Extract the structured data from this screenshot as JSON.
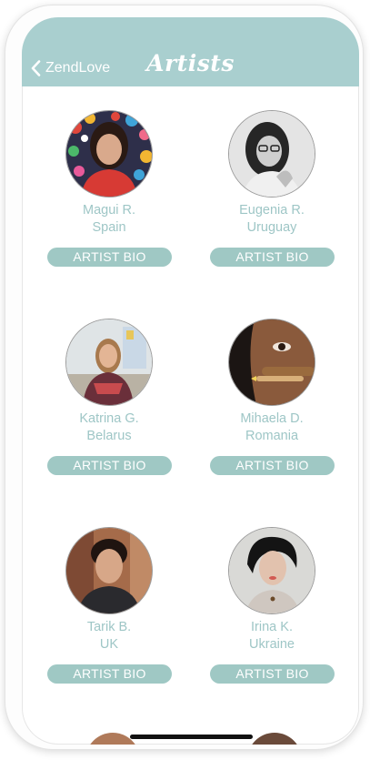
{
  "navbar": {
    "back_label": "ZendLove",
    "title": "Artists"
  },
  "artists": [
    {
      "name": "Magui R.",
      "country": "Spain",
      "button": "ARTIST BIO"
    },
    {
      "name": "Eugenia R.",
      "country": "Uruguay",
      "button": "ARTIST BIO"
    },
    {
      "name": "Katrina G.",
      "country": "Belarus",
      "button": "ARTIST BIO"
    },
    {
      "name": "Mihaela D.",
      "country": "Romania",
      "button": "ARTIST BIO"
    },
    {
      "name": "Tarik B.",
      "country": "UK",
      "button": "ARTIST BIO"
    },
    {
      "name": "Irina K.",
      "country": "Ukraine",
      "button": "ARTIST BIO"
    }
  ],
  "colors": {
    "accent": "#a9cfcf",
    "button": "#9fc8c4",
    "text": "#9ec6c6"
  }
}
